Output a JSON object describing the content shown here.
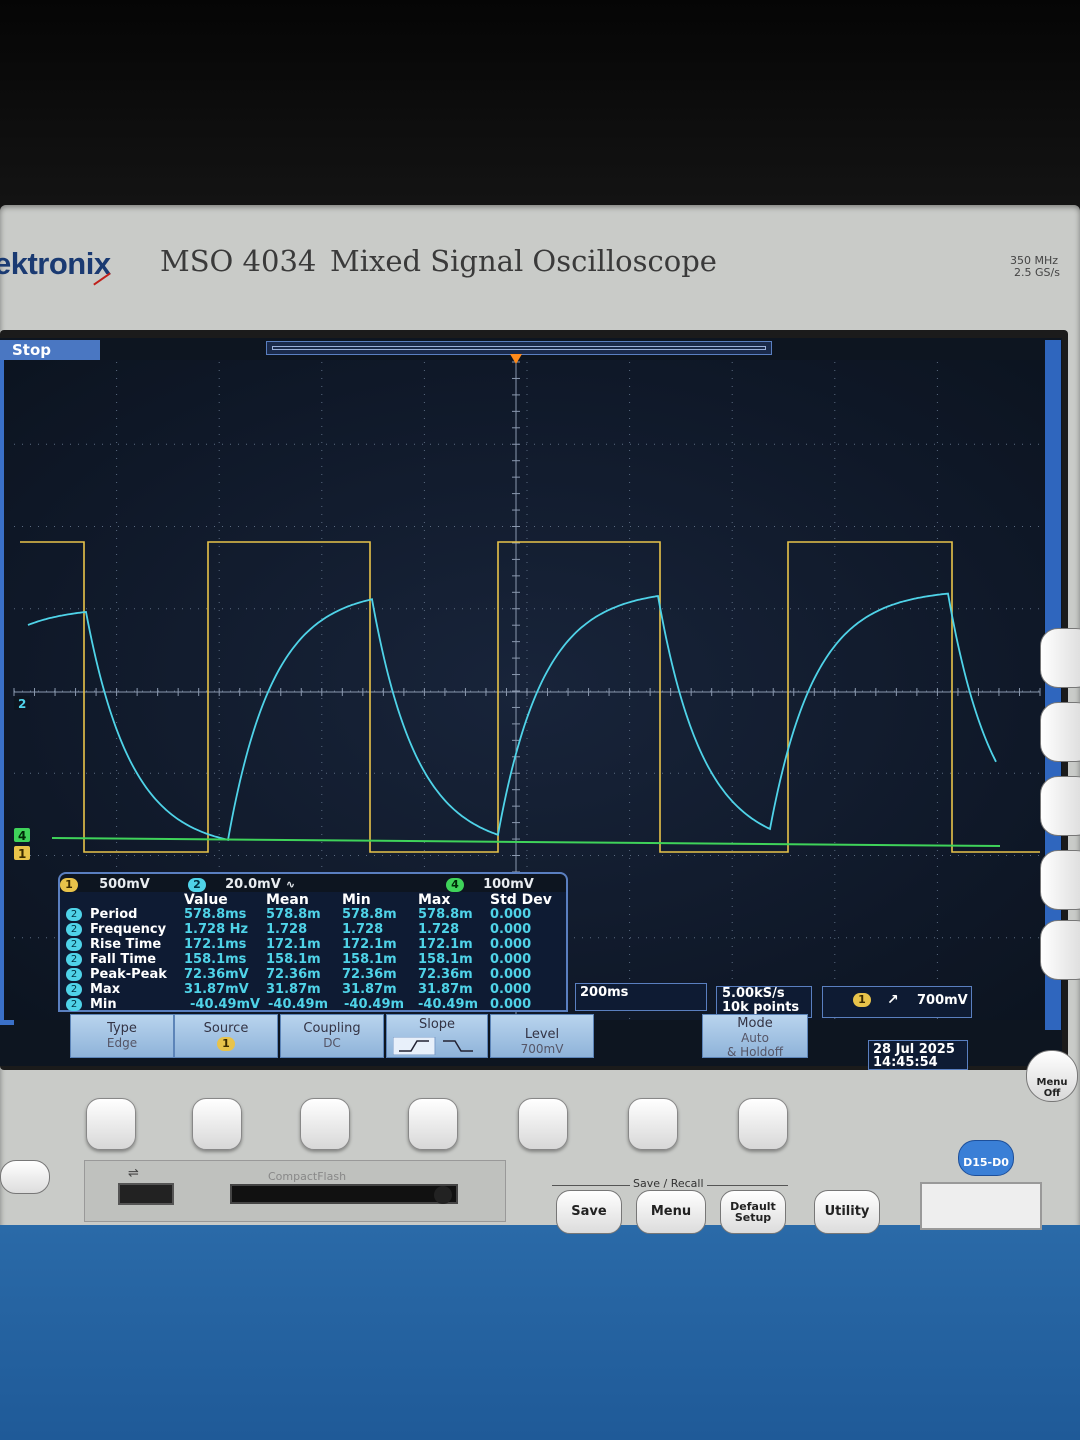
{
  "header": {
    "brand": "ektronix",
    "model": "MSO 4034",
    "model_desc": "Mixed Signal Oscilloscope",
    "spec_bandwidth": "350 MHz",
    "spec_rate": "2.5 GS/s"
  },
  "status": {
    "acq_state": "Stop"
  },
  "channels": {
    "ch1": {
      "label": "1",
      "scale": "500mV",
      "color": "#e8c34a"
    },
    "ch2": {
      "label": "2",
      "scale": "20.0mV",
      "color": "#4fd3e8"
    },
    "ch4": {
      "label": "4",
      "scale": "100mV",
      "color": "#3fd35a"
    }
  },
  "measurements": {
    "headers": [
      "Value",
      "Mean",
      "Min",
      "Max",
      "Std Dev"
    ],
    "rows": [
      {
        "ch": "2",
        "name": "Period",
        "value": "578.8ms",
        "mean": "578.8m",
        "min": "578.8m",
        "max": "578.8m",
        "std": "0.000"
      },
      {
        "ch": "2",
        "name": "Frequency",
        "value": "1.728 Hz",
        "mean": "1.728",
        "min": "1.728",
        "max": "1.728",
        "std": "0.000"
      },
      {
        "ch": "2",
        "name": "Rise Time",
        "value": "172.1ms",
        "mean": "172.1m",
        "min": "172.1m",
        "max": "172.1m",
        "std": "0.000"
      },
      {
        "ch": "2",
        "name": "Fall Time",
        "value": "158.1ms",
        "mean": "158.1m",
        "min": "158.1m",
        "max": "158.1m",
        "std": "0.000"
      },
      {
        "ch": "2",
        "name": "Peak-Peak",
        "value": "72.36mV",
        "mean": "72.36m",
        "min": "72.36m",
        "max": "72.36m",
        "std": "0.000"
      },
      {
        "ch": "2",
        "name": "Max",
        "value": "31.87mV",
        "mean": "31.87m",
        "min": "31.87m",
        "max": "31.87m",
        "std": "0.000"
      },
      {
        "ch": "2",
        "name": "Min",
        "value": "-40.49mV",
        "mean": "-40.49m",
        "min": "-40.49m",
        "max": "-40.49m",
        "std": "0.000"
      }
    ]
  },
  "timebase": {
    "scale": "200ms",
    "sample_rate": "5.00kS/s",
    "record_length": "10k points"
  },
  "trigger": {
    "source": "1",
    "level": "700mV"
  },
  "softkeys": {
    "type": {
      "label": "Type",
      "value": "Edge"
    },
    "source": {
      "label": "Source",
      "value": "1"
    },
    "coupling": {
      "label": "Coupling",
      "value": "DC"
    },
    "slope": {
      "label": "Slope"
    },
    "level": {
      "label": "Level",
      "value": "700mV"
    },
    "mode": {
      "label": "Mode",
      "value1": "Auto",
      "value2": "& Holdoff"
    }
  },
  "datetime": {
    "date": "28 Jul  2025",
    "time": "14:45:54"
  },
  "panel": {
    "save": "Save",
    "menu": "Menu",
    "default_setup_1": "Default",
    "default_setup_2": "Setup",
    "utility": "Utility",
    "save_recall_group": "Save / Recall",
    "menu_off_1": "Menu",
    "menu_off_2": "Off",
    "digital_btn": "D15-D0",
    "cf_label": "CompactFlash"
  }
}
